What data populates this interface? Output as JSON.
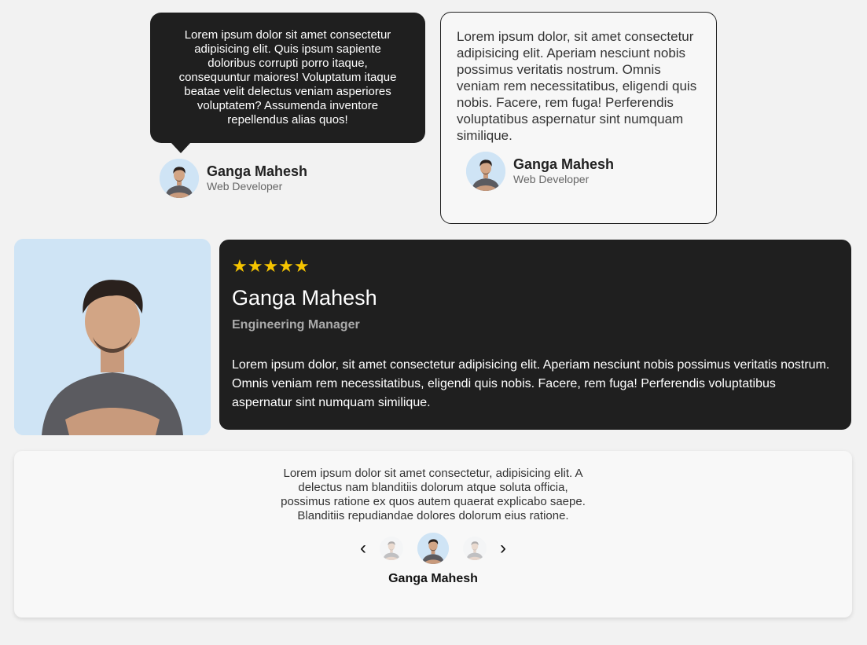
{
  "card1": {
    "quote": "Lorem ipsum dolor sit amet consectetur adipisicing elit. Quis ipsum sapiente doloribus corrupti porro itaque, consequuntur maiores! Voluptatum itaque beatae velit delectus veniam asperiores voluptatem? Assumenda inventore repellendus alias quos!",
    "name": "Ganga Mahesh",
    "role": "Web Developer"
  },
  "card2": {
    "quote": "Lorem ipsum dolor, sit amet consectetur adipisicing elit. Aperiam nesciunt nobis possimus veritatis nostrum. Omnis veniam rem necessitatibus, eligendi quis nobis. Facere, rem fuga! Perferendis voluptatibus aspernatur sint numquam similique.",
    "name": "Ganga Mahesh",
    "role": "Web Developer"
  },
  "card3": {
    "stars": "★★★★★",
    "rating": 5,
    "name": "Ganga Mahesh",
    "role": "Engineering Manager",
    "quote": "Lorem ipsum dolor, sit amet consectetur adipisicing elit. Aperiam nesciunt nobis possimus veritatis nostrum. Omnis veniam rem necessitatibus, eligendi quis nobis. Facere, rem fuga! Perferendis voluptatibus aspernatur sint numquam similique."
  },
  "card4": {
    "quote": "Lorem ipsum dolor sit amet consectetur, adipisicing elit. A delectus nam blanditiis dolorum atque soluta officia, possimus ratione ex quos autem quaerat explicabo saepe. Blanditiis repudiandae dolores dolorum eius ratione.",
    "prev_arrow": "‹",
    "next_arrow": "›",
    "name": "Ganga Mahesh"
  },
  "colors": {
    "dark_card": "#1f1f1f",
    "star": "#f5c400",
    "avatar_bg": "#cfe4f5"
  }
}
